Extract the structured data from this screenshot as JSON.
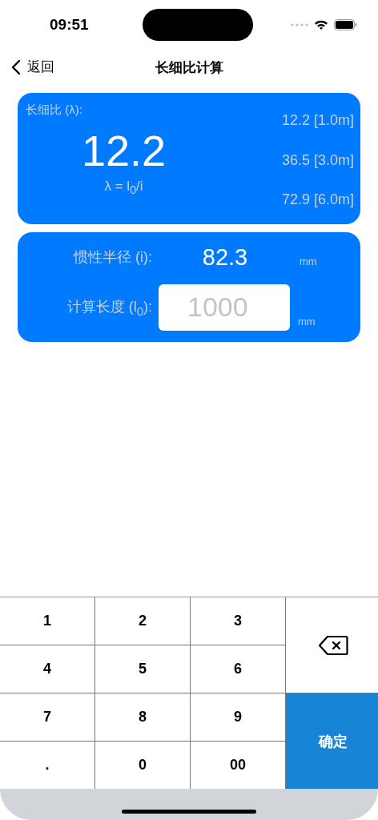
{
  "status_bar": {
    "time": "09:51"
  },
  "nav": {
    "back": "返回",
    "title": "长细比计算"
  },
  "result_card": {
    "label": "长细比 (λ):",
    "value": "12.2",
    "formula": "λ = l$_{0}$/i",
    "readings": [
      "12.2 [1.0m]",
      "36.5 [3.0m]",
      "72.9 [6.0m]"
    ]
  },
  "input_card": {
    "radius_label": "惯性半径 (i):",
    "radius_value": "82.3",
    "radius_unit": "mm",
    "length_label": "计算长度 (l$_{0}$):",
    "length_placeholder": "1000",
    "length_unit": "mm"
  },
  "keypad": {
    "keys": [
      {
        "kind": "digit",
        "label": "1"
      },
      {
        "kind": "digit",
        "label": "2"
      },
      {
        "kind": "digit",
        "label": "3"
      },
      {
        "kind": "delete"
      },
      {
        "kind": "digit",
        "label": "4"
      },
      {
        "kind": "digit",
        "label": "5"
      },
      {
        "kind": "digit",
        "label": "6"
      },
      {
        "kind": "digit",
        "label": "7"
      },
      {
        "kind": "digit",
        "label": "8"
      },
      {
        "kind": "digit",
        "label": "9"
      },
      {
        "kind": "confirm",
        "label": "确定"
      },
      {
        "kind": "digit",
        "label": "."
      },
      {
        "kind": "digit",
        "label": "0"
      },
      {
        "kind": "digit",
        "label": "00"
      }
    ]
  }
}
